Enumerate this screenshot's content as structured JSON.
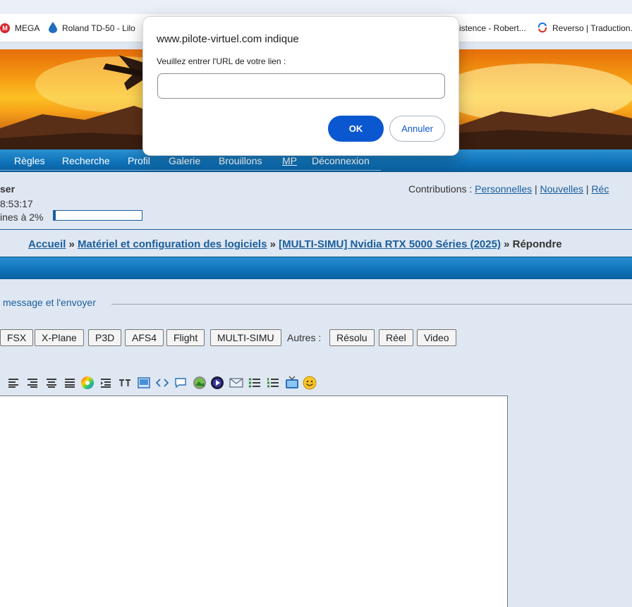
{
  "bookmarks": [
    {
      "label": "MEGA",
      "icon": "mega-icon"
    },
    {
      "label": "Roland TD-50 - Lilo",
      "icon": "droplet-icon"
    },
    {
      "label": "istence - Robert...",
      "icon": ""
    },
    {
      "label": "Reverso | Traduction...",
      "icon": "reverso-icon"
    }
  ],
  "nav": {
    "items": [
      "Règles",
      "Recherche",
      "Profil",
      "Galerie",
      "Brouillons",
      "MP",
      "Déconnexion"
    ]
  },
  "user": {
    "name": "ser",
    "time": "8:53:17",
    "quota_label": "ines à 2%",
    "quota_value": 0.02
  },
  "contributions": {
    "label": "Contributions :",
    "links": [
      "Personnelles",
      "Nouvelles",
      "Réc"
    ]
  },
  "breadcrumb": {
    "items": [
      "Accueil",
      "Matériel et configuration des logiciels",
      "[MULTI-SIMU] Nvidia RTX 5000 Séries (2025)"
    ],
    "current": "Répondre",
    "sep": "»"
  },
  "form": {
    "legend": " message et l'envoyer"
  },
  "tags": {
    "sims": [
      "FSX",
      "X-Plane",
      "P3D",
      "AFS4",
      "Flight",
      "MULTI-SIMU"
    ],
    "others_label": "Autres :",
    "others": [
      "Résolu",
      "Réel",
      "Video"
    ]
  },
  "toolbar": {
    "tools": [
      "align-left-icon",
      "align-right-icon",
      "align-center-icon",
      "align-justify-icon",
      "color-wheel-icon",
      "indent-icon",
      "font-size-icon",
      "box-icon",
      "code-icon",
      "quote-bubble-icon",
      "image-icon",
      "media-icon",
      "email-icon",
      "bullet-list-icon",
      "numbered-list-icon",
      "video-icon",
      "smiley-icon"
    ]
  },
  "dialog": {
    "title": "www.pilote-virtuel.com indique",
    "message": "Veuillez entrer l'URL de votre lien :",
    "input_value": "",
    "ok_label": "OK",
    "cancel_label": "Annuler"
  },
  "colors": {
    "link": "#1a5e9c",
    "nav_bar": "#0f72b8",
    "ok_button": "#0b57d0"
  }
}
